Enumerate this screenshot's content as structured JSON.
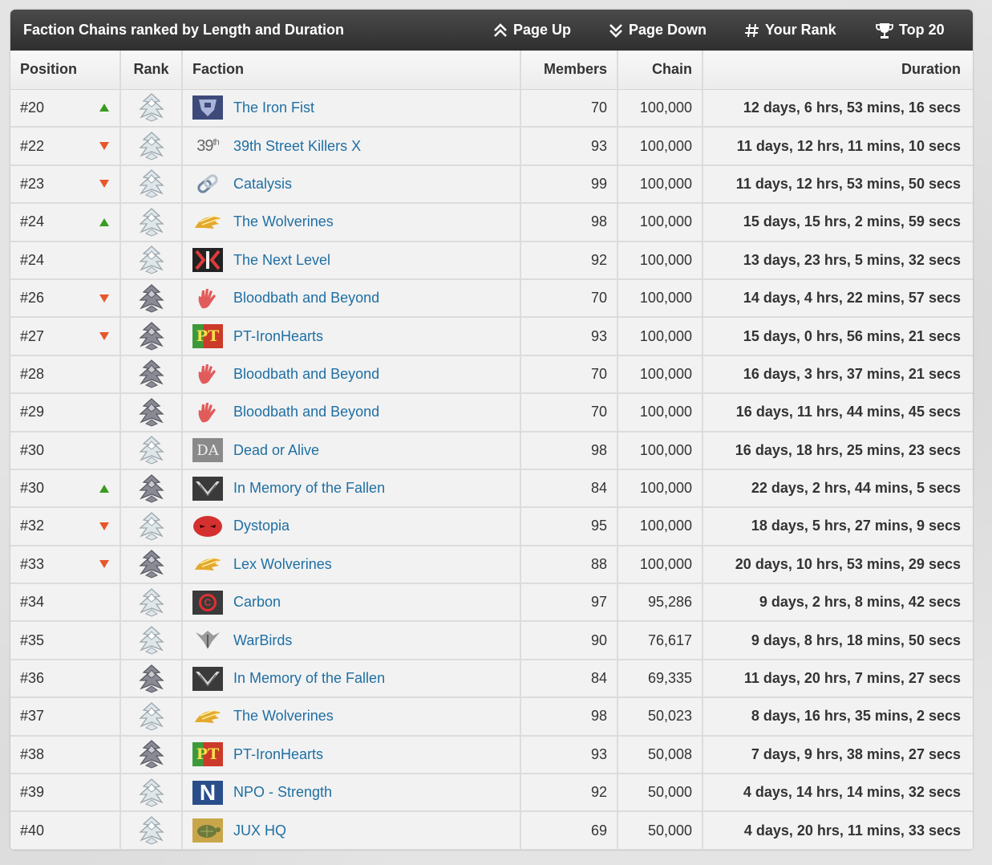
{
  "header": {
    "title": "Faction Chains ranked by Length and Duration",
    "page_up": "Page Up",
    "page_down": "Page Down",
    "your_rank": "Your Rank",
    "top20": "Top 20"
  },
  "columns": {
    "position": "Position",
    "rank": "Rank",
    "faction": "Faction",
    "members": "Members",
    "chain": "Chain",
    "duration": "Duration"
  },
  "colors": {
    "up": "#3a9a1e",
    "down": "#e8562a",
    "link": "#1f6fa3"
  },
  "rows": [
    {
      "position": "#20",
      "trend": "up",
      "rank": "silver",
      "logo": "transformer-icon",
      "logo_text": "",
      "faction": "The Iron Fist",
      "members": "70",
      "chain": "100,000",
      "duration": "12 days, 6 hrs, 53 mins, 16 secs"
    },
    {
      "position": "#22",
      "trend": "down",
      "rank": "silver",
      "logo": "39th-text-icon",
      "logo_text": "39th",
      "faction": "39th Street Killers X",
      "members": "93",
      "chain": "100,000",
      "duration": "11 days, 12 hrs, 11 mins, 10 secs"
    },
    {
      "position": "#23",
      "trend": "down",
      "rank": "silver",
      "logo": "chain-link-icon",
      "logo_text": "",
      "faction": "Catalysis",
      "members": "99",
      "chain": "100,000",
      "duration": "11 days, 12 hrs, 53 mins, 50 secs"
    },
    {
      "position": "#24",
      "trend": "up",
      "rank": "silver",
      "logo": "wolverine-claw-icon",
      "logo_text": "",
      "faction": "The Wolverines",
      "members": "98",
      "chain": "100,000",
      "duration": "15 days, 15 hrs, 2 mins, 59 secs"
    },
    {
      "position": "#24",
      "trend": "none",
      "rank": "silver",
      "logo": "nl-icon",
      "logo_text": "",
      "faction": "The Next Level",
      "members": "92",
      "chain": "100,000",
      "duration": "13 days, 23 hrs, 5 mins, 32 secs"
    },
    {
      "position": "#26",
      "trend": "down",
      "rank": "dark",
      "logo": "red-hand-icon",
      "logo_text": "",
      "faction": "Bloodbath and Beyond",
      "members": "70",
      "chain": "100,000",
      "duration": "14 days, 4 hrs, 22 mins, 57 secs"
    },
    {
      "position": "#27",
      "trend": "down",
      "rank": "dark",
      "logo": "pt-icon",
      "logo_text": "PT",
      "faction": "PT-IronHearts",
      "members": "93",
      "chain": "100,000",
      "duration": "15 days, 0 hrs, 56 mins, 21 secs"
    },
    {
      "position": "#28",
      "trend": "none",
      "rank": "dark",
      "logo": "red-hand-icon",
      "logo_text": "",
      "faction": "Bloodbath and Beyond",
      "members": "70",
      "chain": "100,000",
      "duration": "16 days, 3 hrs, 37 mins, 21 secs"
    },
    {
      "position": "#29",
      "trend": "none",
      "rank": "dark",
      "logo": "red-hand-icon",
      "logo_text": "",
      "faction": "Bloodbath and Beyond",
      "members": "70",
      "chain": "100,000",
      "duration": "16 days, 11 hrs, 44 mins, 45 secs"
    },
    {
      "position": "#30",
      "trend": "none",
      "rank": "silver",
      "logo": "doa-icon",
      "logo_text": "DA",
      "faction": "Dead or Alive",
      "members": "98",
      "chain": "100,000",
      "duration": "16 days, 18 hrs, 25 mins, 23 secs"
    },
    {
      "position": "#30",
      "trend": "up",
      "rank": "dark",
      "logo": "wings-icon",
      "logo_text": "",
      "faction": "In Memory of the Fallen",
      "members": "84",
      "chain": "100,000",
      "duration": "22 days, 2 hrs, 44 mins, 5 secs"
    },
    {
      "position": "#32",
      "trend": "down",
      "rank": "silver",
      "logo": "red-mask-icon",
      "logo_text": "",
      "faction": "Dystopia",
      "members": "95",
      "chain": "100,000",
      "duration": "18 days, 5 hrs, 27 mins, 9 secs"
    },
    {
      "position": "#33",
      "trend": "down",
      "rank": "dark",
      "logo": "wolverine-claw-icon",
      "logo_text": "",
      "faction": "Lex Wolverines",
      "members": "88",
      "chain": "100,000",
      "duration": "20 days, 10 hrs, 53 mins, 29 secs"
    },
    {
      "position": "#34",
      "trend": "none",
      "rank": "silver",
      "logo": "carbon-icon",
      "logo_text": "C",
      "faction": "Carbon",
      "members": "97",
      "chain": "95,286",
      "duration": "9 days, 2 hrs, 8 mins, 42 secs"
    },
    {
      "position": "#35",
      "trend": "none",
      "rank": "silver",
      "logo": "warbird-icon",
      "logo_text": "",
      "faction": "WarBirds",
      "members": "90",
      "chain": "76,617",
      "duration": "9 days, 8 hrs, 18 mins, 50 secs"
    },
    {
      "position": "#36",
      "trend": "none",
      "rank": "dark",
      "logo": "wings-icon",
      "logo_text": "",
      "faction": "In Memory of the Fallen",
      "members": "84",
      "chain": "69,335",
      "duration": "11 days, 20 hrs, 7 mins, 27 secs"
    },
    {
      "position": "#37",
      "trend": "none",
      "rank": "silver",
      "logo": "wolverine-claw-icon",
      "logo_text": "",
      "faction": "The Wolverines",
      "members": "98",
      "chain": "50,023",
      "duration": "8 days, 16 hrs, 35 mins, 2 secs"
    },
    {
      "position": "#38",
      "trend": "none",
      "rank": "dark",
      "logo": "pt-icon",
      "logo_text": "PT",
      "faction": "PT-IronHearts",
      "members": "93",
      "chain": "50,008",
      "duration": "7 days, 9 hrs, 38 mins, 27 secs"
    },
    {
      "position": "#39",
      "trend": "none",
      "rank": "silver",
      "logo": "n-icon",
      "logo_text": "N",
      "faction": "NPO - Strength",
      "members": "92",
      "chain": "50,000",
      "duration": "4 days, 14 hrs, 14 mins, 32 secs"
    },
    {
      "position": "#40",
      "trend": "none",
      "rank": "silver",
      "logo": "turtle-icon",
      "logo_text": "",
      "faction": "JUX HQ",
      "members": "69",
      "chain": "50,000",
      "duration": "4 days, 20 hrs, 11 mins, 33 secs"
    }
  ]
}
